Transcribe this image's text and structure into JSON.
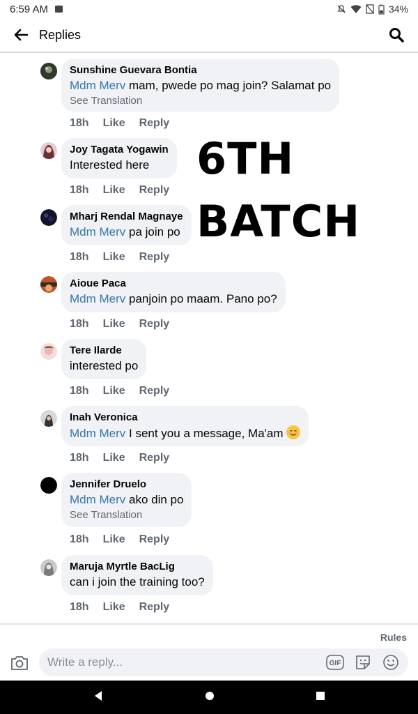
{
  "status_bar": {
    "time": "6:59 AM",
    "battery": "34%"
  },
  "header": {
    "title": "Replies"
  },
  "overlay": {
    "line1": "6TH",
    "line2": "BATCH"
  },
  "comments": [
    {
      "author": "Sunshine Guevara Bontia",
      "mention": "Mdm Merv",
      "text": " mam, pwede po mag join? Salamat po",
      "see_translation": "See Translation",
      "time": "18h",
      "like": "Like",
      "reply": "Reply"
    },
    {
      "author": "Joy Tagata Yogawin",
      "mention": "",
      "text": "Interested here",
      "time": "18h",
      "like": "Like",
      "reply": "Reply"
    },
    {
      "author": "Mharj Rendal Magnaye",
      "mention": "Mdm Merv",
      "text": " pa join po",
      "time": "18h",
      "like": "Like",
      "reply": "Reply"
    },
    {
      "author": "Aioue Paca",
      "mention": "Mdm Merv",
      "text": " panjoin po maam. Pano po?",
      "time": "18h",
      "like": "Like",
      "reply": "Reply"
    },
    {
      "author": "Tere Ilarde",
      "mention": "",
      "text": "interested po",
      "time": "18h",
      "like": "Like",
      "reply": "Reply"
    },
    {
      "author": "Inah Veronica",
      "mention": "Mdm Merv",
      "text": " I sent you a message, Ma'am",
      "time": "18h",
      "like": "Like",
      "reply": "Reply"
    },
    {
      "author": "Jennifer Druelo",
      "mention": "Mdm Merv",
      "text": " ako din po",
      "see_translation": "See Translation",
      "time": "18h",
      "like": "Like",
      "reply": "Reply"
    },
    {
      "author": "Maruja Myrtle BacLig",
      "mention": "",
      "text": "can i join the training too?",
      "time": "18h",
      "like": "Like",
      "reply": "Reply"
    }
  ],
  "composer": {
    "rules_label": "Rules",
    "placeholder": "Write a reply..."
  },
  "icons": {
    "back": "arrow-left-icon",
    "search": "search-icon",
    "camera": "camera-icon",
    "gif": "gif-icon",
    "sticker": "sticker-icon",
    "emoji": "emoji-icon",
    "nav_back": "triangle-back-icon",
    "nav_home": "circle-home-icon",
    "nav_recents": "square-recents-icon"
  },
  "colors": {
    "mention": "#3578a8",
    "bubble": "#f0f2f5",
    "action_text": "#606770"
  }
}
